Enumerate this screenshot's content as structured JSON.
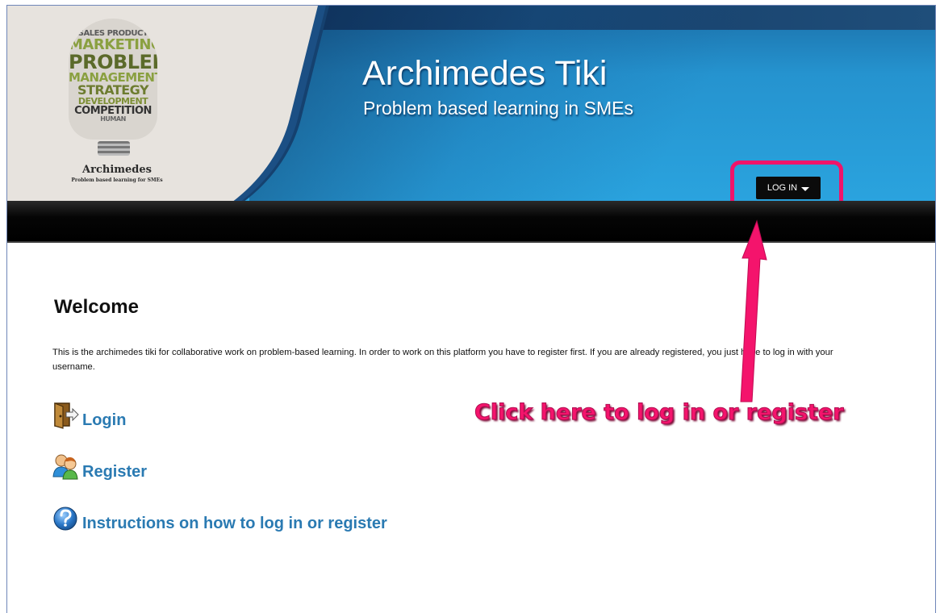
{
  "header": {
    "logo": {
      "words": [
        "SALES PRODUCT",
        "MARKETING",
        "PROBLEMS",
        "MANAGEMENT",
        "STRATEGY",
        "DEVELOPMENT",
        "COMPETITION",
        "HUMAN"
      ],
      "title": "Archimedes",
      "subtitle": "Problem based learning for SMEs"
    },
    "site_title": "Archimedes Tiki",
    "site_subtitle": "Problem based learning in SMEs",
    "login_button": "LOG IN"
  },
  "main": {
    "heading": "Welcome",
    "intro": "This is the archimedes tiki for collaborative work on problem-based learning. In order to work on this platform you have to register first. If you are already registered, you just have to log in with your username.",
    "links": [
      {
        "label": "Login",
        "icon": "door-exit-icon"
      },
      {
        "label": "Register",
        "icon": "users-icon"
      },
      {
        "label": "Instructions on how to log in or register",
        "icon": "help-icon"
      }
    ]
  },
  "annotation": {
    "text": "Click here to log in or register",
    "color": "#f4146c"
  },
  "colors": {
    "header_blue": "#2aa3de",
    "navbar": "#000000",
    "link": "#2a7ab2",
    "highlight": "#f0146a"
  }
}
